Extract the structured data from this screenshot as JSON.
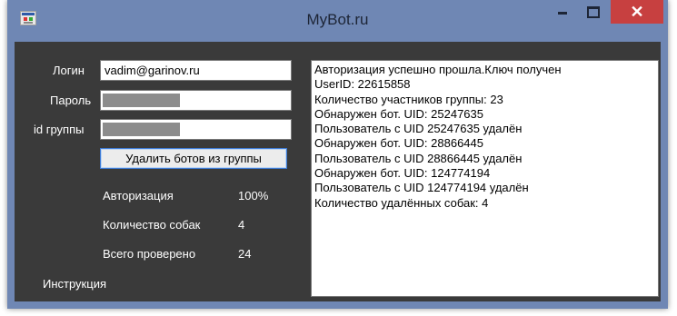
{
  "window": {
    "title": "MyBot.ru",
    "close_glyph": "✕"
  },
  "form": {
    "login_label": "Логин",
    "login_value": "vadim@garinov.ru",
    "password_label": "Пароль",
    "group_label": "id группы",
    "action_button": "Удалить ботов из группы"
  },
  "stats": [
    {
      "label": "Авторизация",
      "value": "100%"
    },
    {
      "label": "Количество собак",
      "value": "4"
    },
    {
      "label": "Всего проверено",
      "value": "24"
    }
  ],
  "instructions_link": "Инструкция",
  "log": [
    "Авторизация успешно прошла.Ключ получен",
    "UserID: 22615858",
    "Количество участников группы: 23",
    "Обнаружен бот. UID: 25247635",
    "Пользователь с UID 25247635 удалён",
    "Обнаружен бот. UID: 28866445",
    "Пользователь с UID 28866445 удалён",
    "Обнаружен бот. UID: 124774194",
    "Пользователь с UID 124774194 удалён",
    "Количество удалённых собак: 4"
  ]
}
